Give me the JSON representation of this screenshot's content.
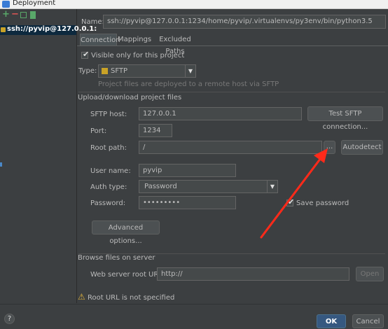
{
  "window": {
    "title": "Deployment"
  },
  "left": {
    "add_icon": "+",
    "remove_icon": "−",
    "server_item": "ssh://pyvip@127.0.0.1:"
  },
  "name": {
    "label": "Name:",
    "value": "ssh://pyvip@127.0.0.1:1234/home/pyvip/.virtualenvs/py3env/bin/python3.5"
  },
  "tabs": [
    "Connection",
    "Mappings",
    "Excluded Paths"
  ],
  "connection": {
    "visible_only_label": "Visible only for this project",
    "type_label": "Type:",
    "type_value": "SFTP",
    "type_hint": "Project files are deployed to a remote host via SFTP",
    "upload_section": "Upload/download project files",
    "host_label": "SFTP host:",
    "host_value": "127.0.0.1",
    "test_button": "Test SFTP connection...",
    "port_label": "Port:",
    "port_value": "1234",
    "root_label": "Root path:",
    "root_value": "/",
    "browse_button": "...",
    "autodetect_button": "Autodetect",
    "user_label": "User name:",
    "user_value": "pyvip",
    "auth_label": "Auth type:",
    "auth_value": "Password",
    "password_label": "Password:",
    "password_value": "•••••••••",
    "save_password_label": "Save password",
    "advanced_button": "Advanced options...",
    "browse_section": "Browse files on server",
    "web_url_label": "Web server root URL:",
    "web_url_value": "http://",
    "open_button": "Open",
    "warning_text": "Root URL is not specified"
  },
  "footer": {
    "help_icon": "?",
    "ok_button": "OK",
    "cancel_button": "Cancel"
  },
  "colors": {
    "background": "#3c3f41",
    "selection": "#0d293e",
    "arrow": "#ff2a1a",
    "warning": "#e0b33c"
  }
}
